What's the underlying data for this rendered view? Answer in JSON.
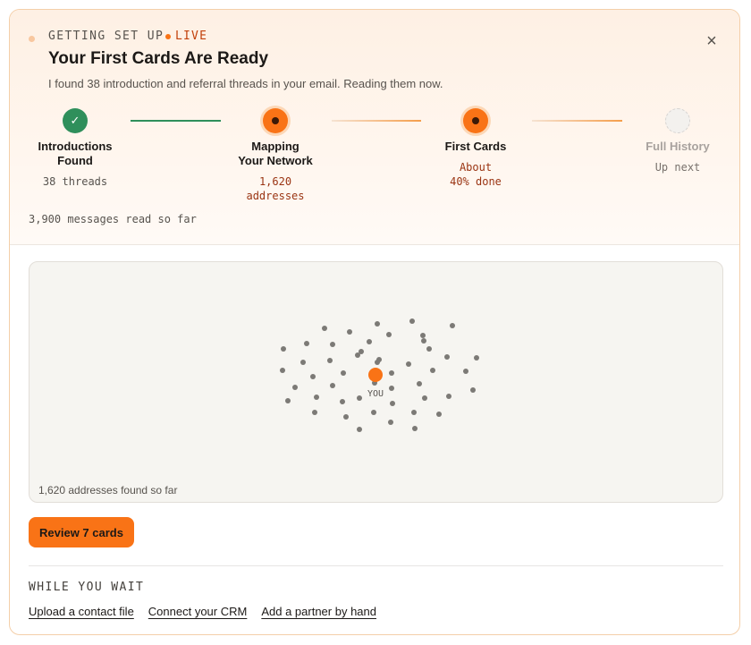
{
  "header": {
    "eyebrow": "GETTING SET UP",
    "live_label": "LIVE",
    "title": "Your First Cards Are Ready",
    "subtitle": "I found 38 introduction and referral threads in your email. Reading them now.",
    "close_icon": "close-icon",
    "close_glyph": "×"
  },
  "steps": [
    {
      "state": "done",
      "icon": "check-icon",
      "glyph": "✓",
      "label_line1": "Introductions",
      "label_line2": "Found",
      "detail_line1": "38 threads",
      "detail_line2": ""
    },
    {
      "state": "active",
      "label_line1": "Mapping",
      "label_line2": "Your Network",
      "detail_line1": "1,620",
      "detail_line2": "addresses"
    },
    {
      "state": "active",
      "label_line1": "First Cards",
      "label_line2": "",
      "detail_line1": "About",
      "detail_line2": "40% done",
      "progress_percent": 40
    },
    {
      "state": "pending",
      "label_line1": "Full History",
      "label_line2": "",
      "detail_line1": "Up next",
      "detail_line2": ""
    }
  ],
  "messages_read": "3,900 messages read so far",
  "network": {
    "center_label": "YOU",
    "caption": "1,620 addresses found so far",
    "node_color": "#7c7a76",
    "center_color": "#f97316"
  },
  "review_button": "Review 7 cards",
  "while_you_wait": {
    "title": "WHILE YOU WAIT",
    "links": [
      "Upload a contact file",
      "Connect your CRM",
      "Add a partner by hand"
    ]
  },
  "colors": {
    "accent": "#f97316",
    "done": "#2f8f5b",
    "accent_text": "#9a3412"
  }
}
